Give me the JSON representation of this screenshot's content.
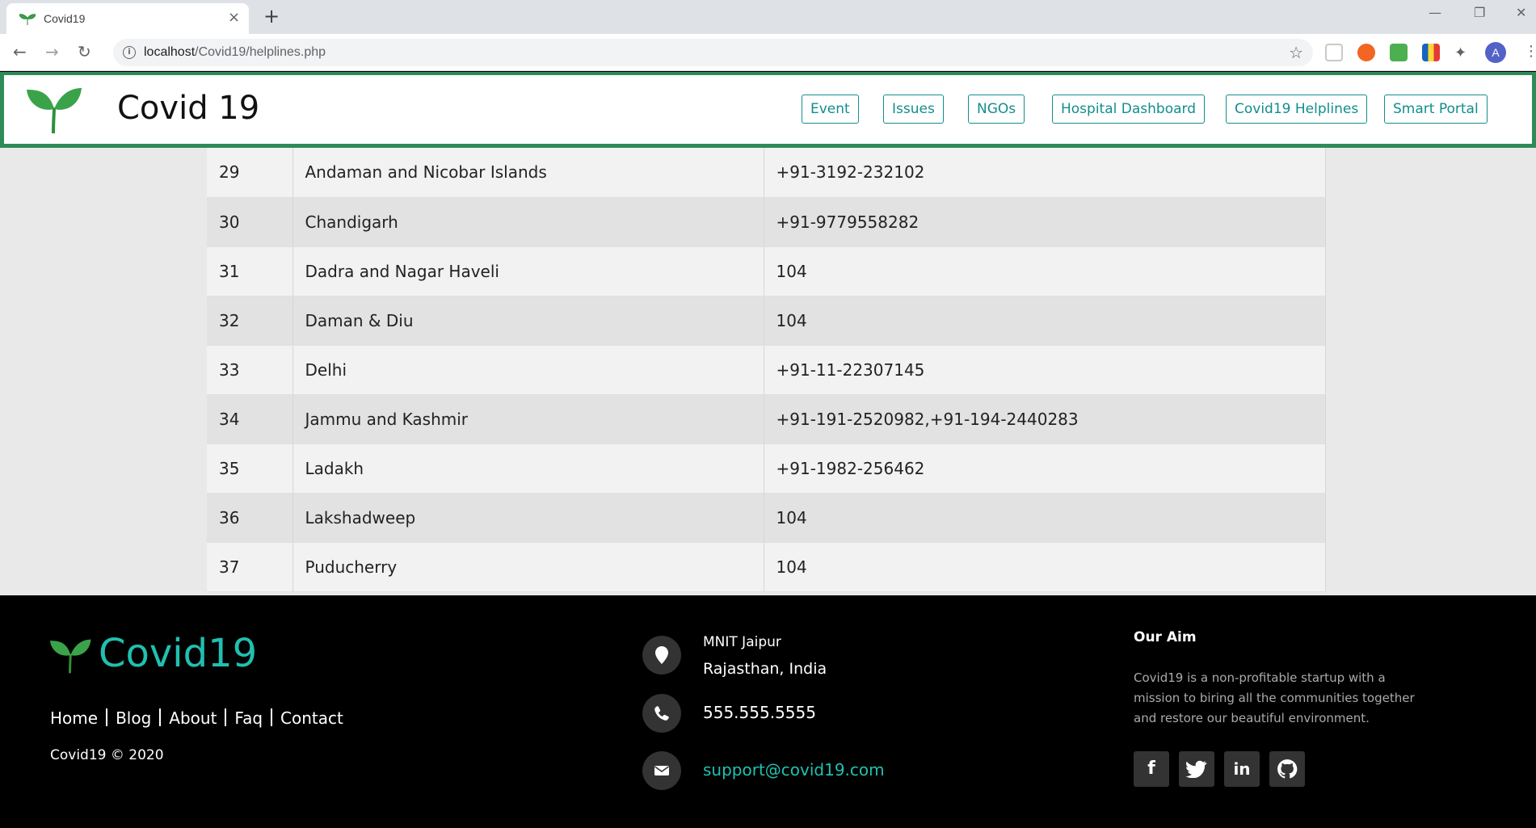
{
  "browser": {
    "tab_title": "Covid19",
    "tab_close": "×",
    "new_tab": "+",
    "url_host": "localhost",
    "url_path": "/Covid19/helplines.php",
    "colors": {
      "tabbar": "#dee1e6",
      "omnibox": "#f1f3f4"
    },
    "icons": [
      "back-icon",
      "forward-icon",
      "reload-icon",
      "info-icon",
      "star-icon",
      "extensions-icon",
      "avatar-icon",
      "menu-icon"
    ],
    "avatar_letter": "A"
  },
  "header": {
    "title": "Covid 19",
    "nav": [
      "Event",
      "Issues",
      "NGOs",
      "Hospital Dashboard",
      "Covid19 Helplines",
      "Smart Portal"
    ],
    "colors": {
      "border": "#2e8b57",
      "pill": "#138d8d"
    }
  },
  "table": {
    "rows": [
      [
        "29",
        "Andaman and Nicobar Islands",
        "+91-3192-232102"
      ],
      [
        "30",
        "Chandigarh",
        "+91-9779558282"
      ],
      [
        "31",
        "Dadra and Nagar Haveli",
        "104"
      ],
      [
        "32",
        "Daman & Diu",
        "104"
      ],
      [
        "33",
        "Delhi",
        "+91-11-22307145"
      ],
      [
        "34",
        "Jammu and Kashmir",
        "+91-191-2520982,+91-194-2440283"
      ],
      [
        "35",
        "Ladakh",
        "+91-1982-256462"
      ],
      [
        "36",
        "Lakshadweep",
        "104"
      ],
      [
        "37",
        "Puducherry",
        "104"
      ]
    ]
  },
  "footer": {
    "brand": "Covid19",
    "links": [
      "Home",
      "Blog",
      "About",
      "Faq",
      "Contact"
    ],
    "copyright": "Covid19 © 2020",
    "address_line1": "MNIT Jaipur",
    "address_line2": "Rajasthan, India",
    "phone": "555.555.5555",
    "email": "support@covid19.com",
    "aim_title": "Our Aim",
    "aim_text": "Covid19 is a non-profitable startup with a mission to biring all the communities together and restore our beautiful environment.",
    "social": [
      "facebook-icon",
      "twitter-icon",
      "linkedin-icon",
      "github-icon"
    ],
    "colors": {
      "accent": "#20c0b0",
      "background": "#000000"
    }
  }
}
